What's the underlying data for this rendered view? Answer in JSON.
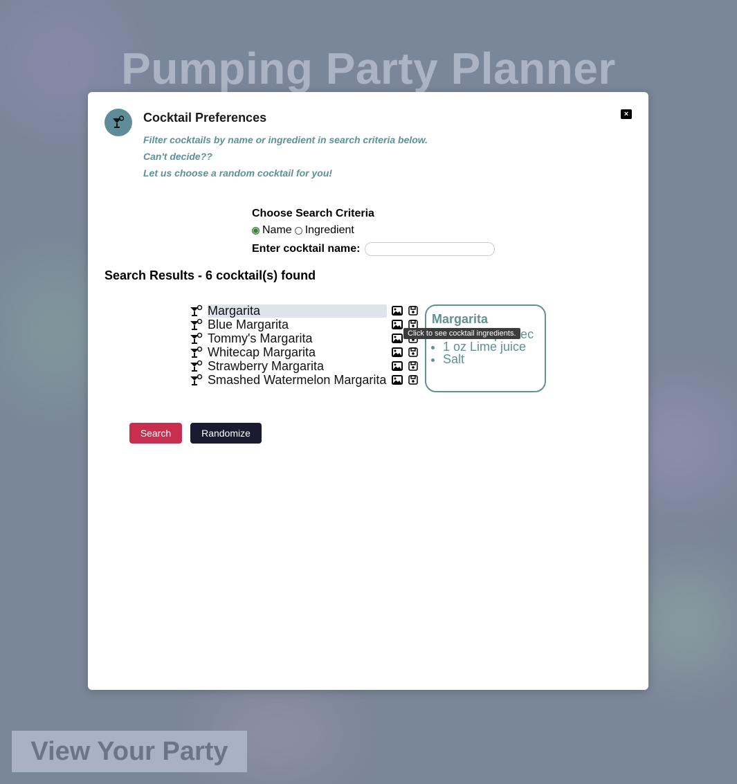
{
  "page": {
    "title": "Pumping Party Planner",
    "view_party_label": "View Your Party"
  },
  "modal": {
    "title": "Cocktail Preferences",
    "close_label": "×",
    "intro_lines": [
      "Filter cocktails by name or ingredient in search criteria below.",
      "Can't decide??",
      "Let us choose a random cocktail for you!"
    ],
    "criteria": {
      "title": "Choose Search Criteria",
      "options": [
        {
          "label": "Name",
          "checked": true
        },
        {
          "label": "Ingredient",
          "checked": false
        }
      ],
      "name_label": "Enter cocktail name:",
      "name_value": "",
      "name_placeholder": ""
    },
    "results": {
      "title": "Search Results - 6 cocktail(s) found",
      "items": [
        "Margarita",
        "Blue Margarita",
        "Tommy's Margarita",
        "Whitecap Margarita",
        "Strawberry Margarita",
        "Smashed Watermelon Margarita"
      ],
      "selected_index": 0
    },
    "detail": {
      "title": "Margarita",
      "ingredients": [
        "1/2 oz Triple sec",
        "1 oz Lime juice",
        "Salt"
      ]
    },
    "tooltip": "Click to see cocktail ingredients.",
    "buttons": {
      "search": "Search",
      "randomize": "Randomize"
    }
  },
  "colors": {
    "accent_teal": "#5f9097",
    "search_button": "#c82e4e",
    "randomize_button": "#1c1a33",
    "backdrop": "#7a8699"
  },
  "icons": {
    "modal_header": "cocktail-glass-icon",
    "result_row": "cocktail-glass-icon",
    "row_actions": [
      "image-icon",
      "save-icon"
    ]
  }
}
